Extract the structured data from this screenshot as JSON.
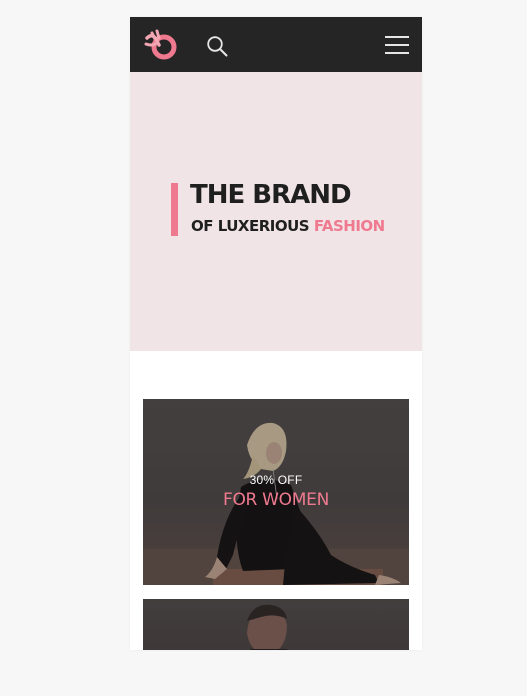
{
  "colors": {
    "header_bg": "#252525",
    "hero_bg": "#f0e4e7",
    "accent": "#ef7a8f",
    "text_dark": "#1f1f1f",
    "page_bg": "#f6f7f6"
  },
  "header": {
    "logo_icon": "brand-logo-icon",
    "search_icon": "search-icon",
    "menu_icon": "hamburger-menu-icon"
  },
  "hero": {
    "title": "THE BRAND",
    "subtitle_plain": "OF LUXERIOUS",
    "subtitle_accent": "FASHION"
  },
  "cards": [
    {
      "offer": "30% OFF",
      "title": "FOR WOMEN"
    },
    {
      "offer": "",
      "title": ""
    }
  ]
}
